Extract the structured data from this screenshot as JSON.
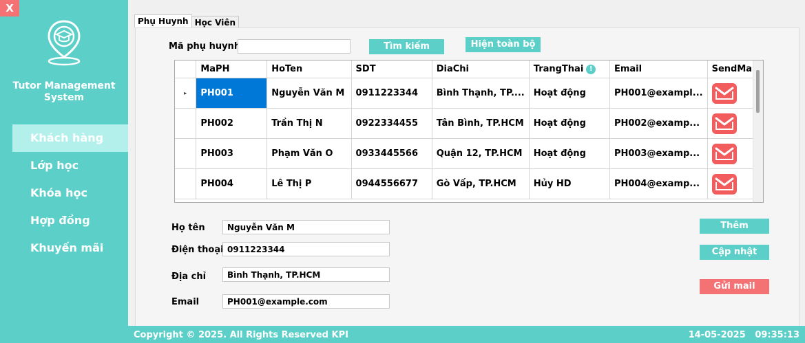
{
  "window": {
    "close_label": "X"
  },
  "sidebar": {
    "app_title_line1": "Tutor Management",
    "app_title_line2": "System",
    "logo_icon": "graduation-cap-pin-icon",
    "items": [
      {
        "label": "Khách hàng",
        "active": true
      },
      {
        "label": "Lớp học"
      },
      {
        "label": "Khóa học"
      },
      {
        "label": "Hợp đồng"
      },
      {
        "label": "Khuyến mãi"
      }
    ]
  },
  "tabs": [
    {
      "label": "Phụ Huynh",
      "active": true
    },
    {
      "label": "Học Viên"
    }
  ],
  "search": {
    "label": "Mã phụ huynh",
    "value": "",
    "search_button": "Tìm kiếm",
    "show_all_button": "Hiện toàn bộ"
  },
  "grid": {
    "columns": [
      "MaPH",
      "HoTen",
      "SDT",
      "DiaChi",
      "TrangThai",
      "Email",
      "SendMail"
    ],
    "rows": [
      [
        "PH001",
        "Nguyễn Văn M",
        "0911223344",
        "Bình Thạnh, TP....",
        "Hoạt động",
        "PH001@exampl..."
      ],
      [
        "PH002",
        "Trần Thị N",
        "0922334455",
        "Tân Bình, TP.HCM",
        "Hoạt động",
        "PH002@examp..."
      ],
      [
        "PH003",
        "Phạm Văn O",
        "0933445566",
        "Quận 12, TP.HCM",
        "Hoạt động",
        "PH003@examp..."
      ],
      [
        "PH004",
        "Lê Thị P",
        "0944556677",
        "Gò Vấp, TP.HCM",
        "Hủy HD",
        "PH004@examp..."
      ]
    ],
    "row_marker": "▸",
    "info_glyph": "!"
  },
  "form": {
    "name_label": "Họ tên",
    "name_value": "Nguyễn Văn M",
    "phone_label": "Điện thoại",
    "phone_value": "0911223344",
    "address_label": "Địa chỉ",
    "address_value": "Bình Thạnh, TP.HCM",
    "email_label": "Email",
    "email_value": "PH001@example.com"
  },
  "actions": {
    "add": "Thêm",
    "update": "Cập nhật",
    "send_mail": "Gửi mail"
  },
  "footer": {
    "copyright": "Copyright © 2025. All Rights Reserved KPI",
    "date": "14-05-2025",
    "time": "09:35:13"
  },
  "colors": {
    "accent": "#5ccfc9",
    "danger": "#f47174",
    "selection": "#0078d7"
  }
}
